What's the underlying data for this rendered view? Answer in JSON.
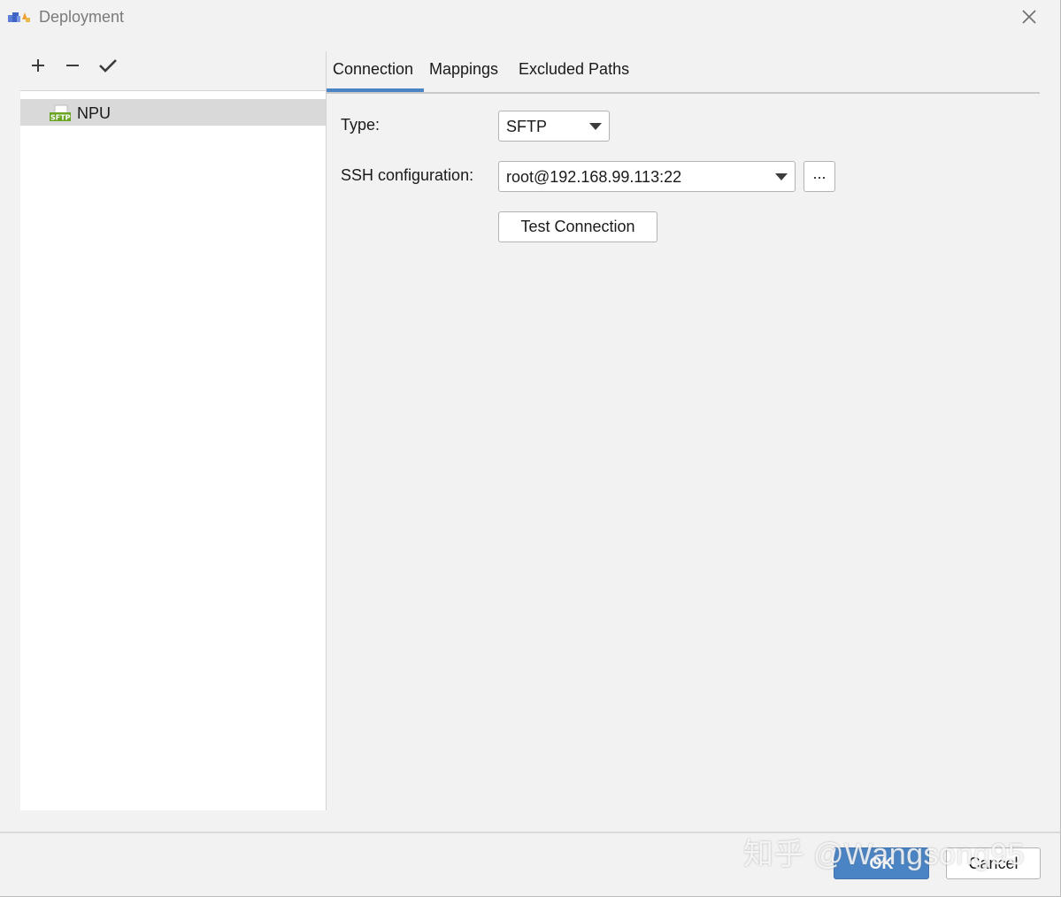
{
  "window": {
    "title": "Deployment",
    "app_icon": "deployment-app-icon",
    "close_icon": "close-icon"
  },
  "left_toolbar": {
    "add_icon": "plus-icon",
    "remove_icon": "minus-icon",
    "default_icon": "checkmark-icon"
  },
  "servers": [
    {
      "name": "NPU",
      "icon": "sftp-server-icon",
      "selected": true
    }
  ],
  "tabs": [
    {
      "label": "Connection",
      "active": true
    },
    {
      "label": "Mappings",
      "active": false
    },
    {
      "label": "Excluded Paths",
      "active": false
    }
  ],
  "form": {
    "type_label": "Type:",
    "type_value": "SFTP",
    "ssh_label": "SSH configuration:",
    "ssh_value": "root@192.168.99.113:22",
    "browse_label": "...",
    "test_connection_label": "Test Connection"
  },
  "footer": {
    "ok_label": "OK",
    "cancel_label": "Cancel"
  },
  "watermark": "知乎 @Wangsong95",
  "colors": {
    "accent": "#4a84c4",
    "selection": "#d9d9d9",
    "background": "#f2f2f2"
  }
}
